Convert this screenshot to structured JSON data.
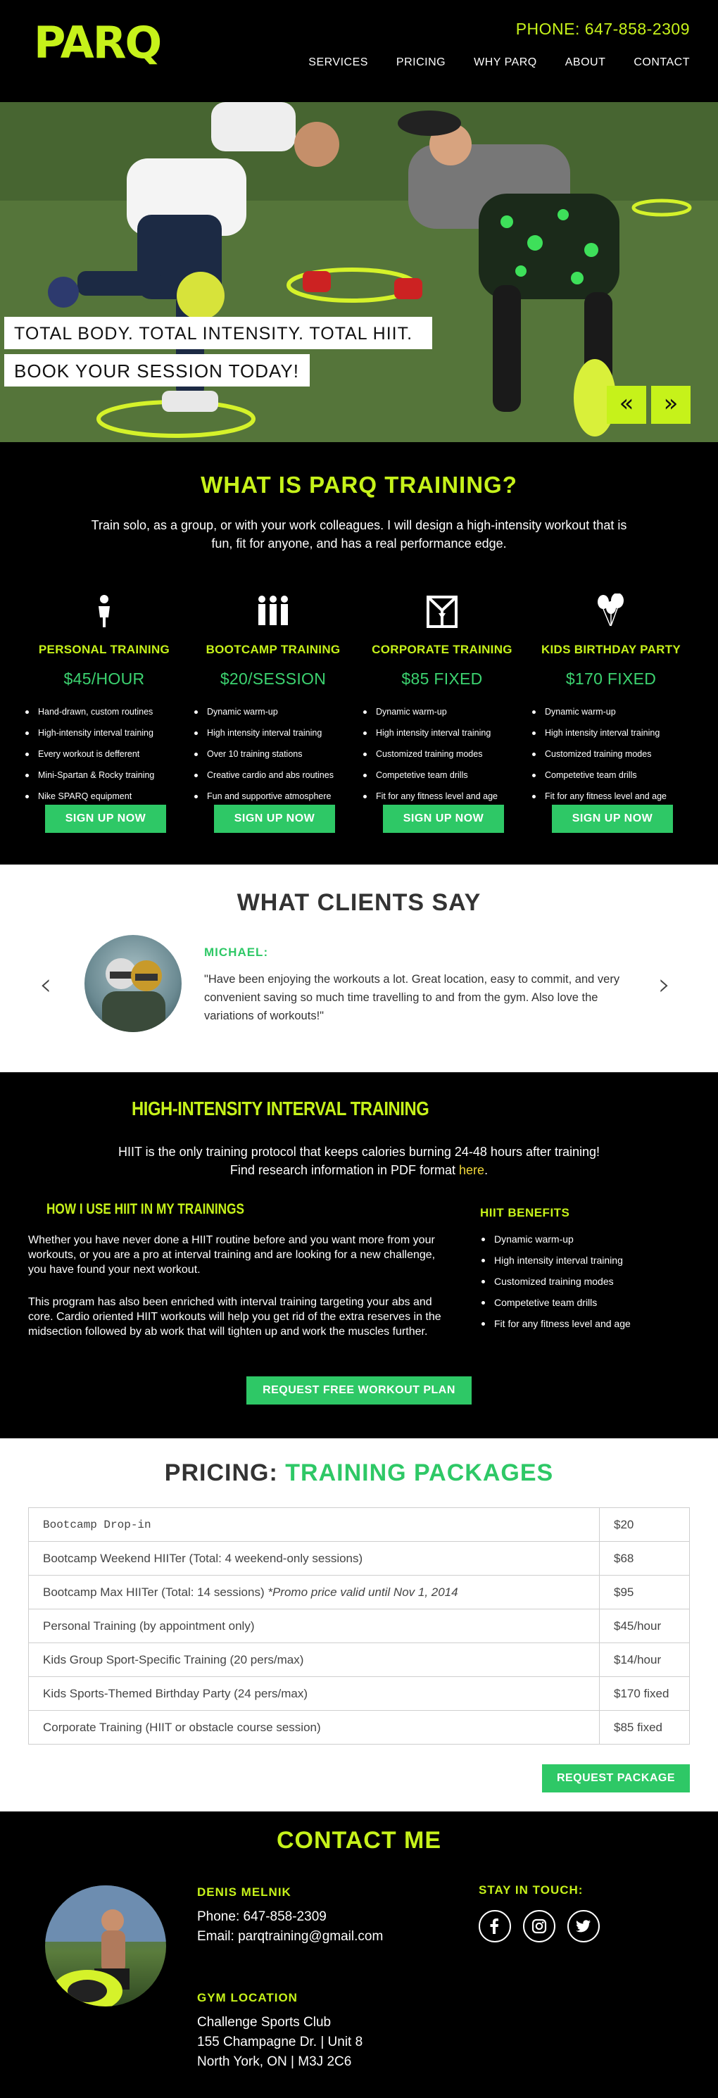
{
  "header": {
    "logo": "PARQ",
    "phone": "PHONE: 647-858-2309",
    "nav": [
      "SERVICES",
      "PRICING",
      "WHY PARQ",
      "ABOUT",
      "CONTACT"
    ]
  },
  "hero": {
    "tagline": "TOTAL BODY. TOTAL INTENSITY. TOTAL HIIT.",
    "cta": "BOOK YOUR SESSION TODAY!",
    "prev_label": "«",
    "next_label": "»"
  },
  "what": {
    "title": "WHAT IS PARQ TRAINING?",
    "intro": "Train solo, as a group, or with your work colleagues. I will design a high-intensity workout that is fun, fit for anyone, and has a real performance edge.",
    "cards": [
      {
        "icon": "person-icon",
        "title": "PERSONAL TRAINING",
        "price": "$45/HOUR",
        "features": [
          "Hand-drawn, custom routines",
          "High-intensity interval training",
          "Every workout is defferent",
          "Mini-Spartan & Rocky training",
          "Nike SPARQ equipment"
        ],
        "button": "SIGN UP NOW"
      },
      {
        "icon": "group-icon",
        "title": "BOOTCAMP TRAINING",
        "price": "$20/SESSION",
        "features": [
          "Dynamic warm-up",
          "High intensity interval training",
          "Over 10 training stations",
          "Creative cardio and abs routines",
          "Fun and supportive atmosphere"
        ],
        "button": "SIGN UP NOW"
      },
      {
        "icon": "corporate-icon",
        "title": "CORPORATE TRAINING",
        "price": "$85 FIXED",
        "features": [
          "Dynamic warm-up",
          "High intensity interval training",
          "Customized training modes",
          "Competetive team drills",
          "Fit for any fitness level and age"
        ],
        "button": "SIGN UP NOW"
      },
      {
        "icon": "balloons-icon",
        "title": "KIDS BIRTHDAY PARTY",
        "price": "$170 FIXED",
        "features": [
          "Dynamic warm-up",
          "High intensity interval training",
          "Customized training modes",
          "Competetive team drills",
          "Fit for any fitness level and age"
        ],
        "button": "SIGN UP NOW"
      }
    ]
  },
  "clients": {
    "title": "WHAT CLIENTS SAY",
    "name": "MICHAEL:",
    "quote": "\"Have been enjoying the workouts a lot. Great location, easy to commit, and very convenient saving so much time travelling to and from the gym. Also love the variations of workouts!\""
  },
  "hiit": {
    "title": "HIGH-INTENSITY INTERVAL TRAINING",
    "intro_line1": "HIIT is the only training protocol that keeps calories burning 24-48 hours after training!",
    "intro_line2": "Find research information in PDF format ",
    "intro_link": "here",
    "intro_end": ".",
    "how_title": "HOW I USE HIIT IN MY TRAININGS",
    "p1": "Whether you have never done a HIIT routine before and you want more from your workouts, or you are a pro at interval training and are looking for a new challenge, you have found your next workout.",
    "p2": "This program has also been enriched with interval training targeting your abs and core. Cardio oriented HIIT workouts will help you get rid of the extra reserves in the midsection followed by ab work that will tighten up and work the muscles further.",
    "benefits_title": "HIIT BENEFITS",
    "benefits": [
      "Dynamic warm-up",
      "High intensity interval training",
      "Customized training modes",
      "Competetive team drills",
      "Fit for any fitness level and age"
    ],
    "button": "REQUEST FREE WORKOUT PLAN"
  },
  "pricing": {
    "title_a": "PRICING: ",
    "title_b": "TRAINING PACKAGES",
    "rows": [
      {
        "name": "Bootcamp Drop-in",
        "note": "",
        "price": "$20"
      },
      {
        "name": "Bootcamp Weekend HIITer (Total: 4 weekend-only sessions)",
        "note": "",
        "price": "$68"
      },
      {
        "name": "Bootcamp Max HIITer (Total: 14 sessions) ",
        "note": "*Promo price valid until Nov 1, 2014",
        "price": "$95"
      },
      {
        "name": "Personal Training (by appointment only)",
        "note": "",
        "price": "$45/hour"
      },
      {
        "name": "Kids Group Sport-Specific Training (20 pers/max)",
        "note": "",
        "price": "$14/hour"
      },
      {
        "name": "Kids Sports-Themed Birthday Party (24 pers/max)",
        "note": "",
        "price": "$170 fixed"
      },
      {
        "name": "Corporate Training (HIIT or obstacle course session)",
        "note": "",
        "price": "$85 fixed"
      }
    ],
    "button": "REQUEST PACKAGE"
  },
  "contact": {
    "title": "CONTACT ME",
    "name": "DENIS MELNIK",
    "phone": "Phone: 647-858-2309",
    "email": "Email: parqtraining@gmail.com",
    "gym_title": "GYM LOCATION",
    "gym_name": "Challenge Sports Club",
    "gym_address": "155 Champagne Dr. | Unit 8",
    "gym_city": "North York, ON | M3J 2C6",
    "social_title": "STAY IN TOUCH:",
    "socials": [
      "facebook-icon",
      "instagram-icon",
      "twitter-icon"
    ]
  },
  "colors": {
    "lime": "#c6f21a",
    "green": "#2ec866",
    "dark": "#000000",
    "link": "#f0d63a"
  }
}
